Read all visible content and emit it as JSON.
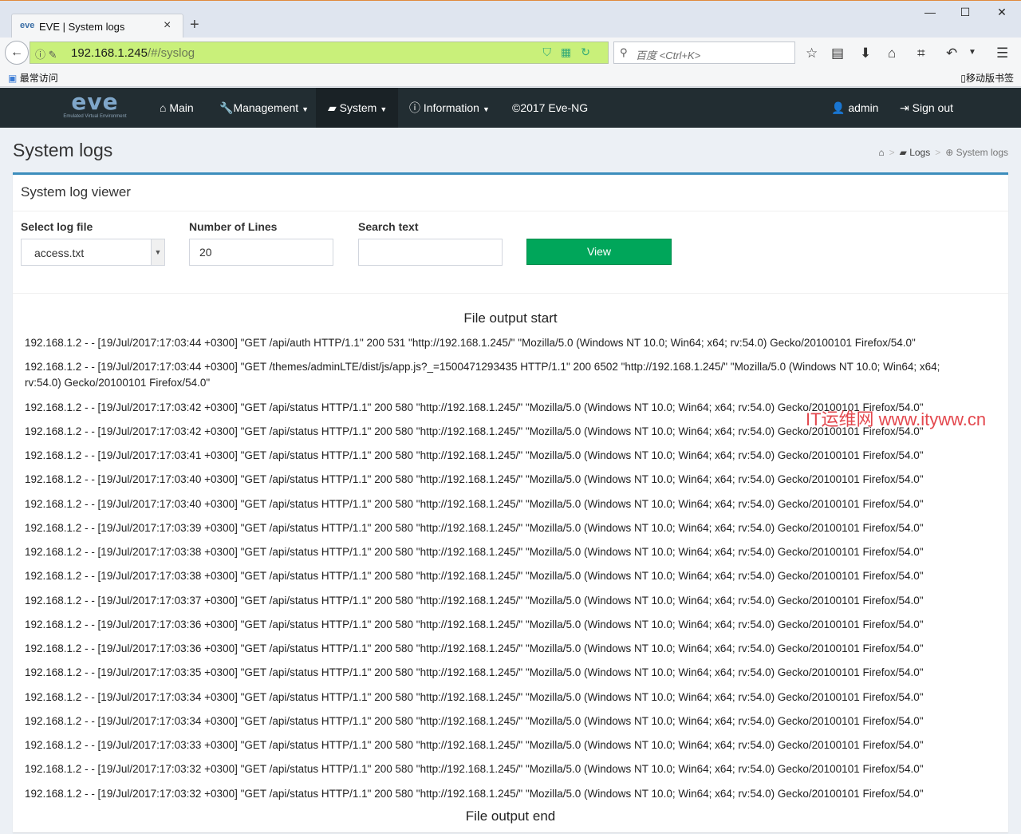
{
  "browser": {
    "tab_title": "EVE | System logs",
    "tab_logo": "eve",
    "url_host": "192.168.1.245",
    "url_path": "/#/syslog",
    "search_placeholder": "百度 <Ctrl+K>",
    "bookmark_left": "最常访问",
    "bookmark_right": "移动版书签"
  },
  "app": {
    "logo_text": "eve",
    "logo_subtext": "Emulated Virtual Environment",
    "nav": {
      "main": "Main",
      "management": "Management",
      "system": "System",
      "information": "Information",
      "copyright": "©2017 Eve-NG",
      "user": "admin",
      "signout": "Sign out"
    }
  },
  "page": {
    "title": "System logs",
    "breadcrumb": {
      "logs": "Logs",
      "current": "System logs"
    },
    "box_title": "System log viewer",
    "form": {
      "log_file_label": "Select log file",
      "log_file_value": "access.txt",
      "lines_label": "Number of Lines",
      "lines_value": "20",
      "search_label": "Search text",
      "search_value": "",
      "view_button": "View"
    },
    "output_start": "File output start",
    "output_end": "File output end",
    "log_lines": [
      "192.168.1.2 - - [19/Jul/2017:17:03:44 +0300] \"GET /api/auth HTTP/1.1\" 200 531 \"http://192.168.1.245/\" \"Mozilla/5.0 (Windows NT 10.0; Win64; x64; rv:54.0) Gecko/20100101 Firefox/54.0\"",
      "192.168.1.2 - - [19/Jul/2017:17:03:44 +0300] \"GET /themes/adminLTE/dist/js/app.js?_=1500471293435 HTTP/1.1\" 200 6502 \"http://192.168.1.245/\" \"Mozilla/5.0 (Windows NT 10.0; Win64; x64; rv:54.0) Gecko/20100101 Firefox/54.0\"",
      "192.168.1.2 - - [19/Jul/2017:17:03:42 +0300] \"GET /api/status HTTP/1.1\" 200 580 \"http://192.168.1.245/\" \"Mozilla/5.0 (Windows NT 10.0; Win64; x64; rv:54.0) Gecko/20100101 Firefox/54.0\"",
      "192.168.1.2 - - [19/Jul/2017:17:03:42 +0300] \"GET /api/status HTTP/1.1\" 200 580 \"http://192.168.1.245/\" \"Mozilla/5.0 (Windows NT 10.0; Win64; x64; rv:54.0) Gecko/20100101 Firefox/54.0\"",
      "192.168.1.2 - - [19/Jul/2017:17:03:41 +0300] \"GET /api/status HTTP/1.1\" 200 580 \"http://192.168.1.245/\" \"Mozilla/5.0 (Windows NT 10.0; Win64; x64; rv:54.0) Gecko/20100101 Firefox/54.0\"",
      "192.168.1.2 - - [19/Jul/2017:17:03:40 +0300] \"GET /api/status HTTP/1.1\" 200 580 \"http://192.168.1.245/\" \"Mozilla/5.0 (Windows NT 10.0; Win64; x64; rv:54.0) Gecko/20100101 Firefox/54.0\"",
      "192.168.1.2 - - [19/Jul/2017:17:03:40 +0300] \"GET /api/status HTTP/1.1\" 200 580 \"http://192.168.1.245/\" \"Mozilla/5.0 (Windows NT 10.0; Win64; x64; rv:54.0) Gecko/20100101 Firefox/54.0\"",
      "192.168.1.2 - - [19/Jul/2017:17:03:39 +0300] \"GET /api/status HTTP/1.1\" 200 580 \"http://192.168.1.245/\" \"Mozilla/5.0 (Windows NT 10.0; Win64; x64; rv:54.0) Gecko/20100101 Firefox/54.0\"",
      "192.168.1.2 - - [19/Jul/2017:17:03:38 +0300] \"GET /api/status HTTP/1.1\" 200 580 \"http://192.168.1.245/\" \"Mozilla/5.0 (Windows NT 10.0; Win64; x64; rv:54.0) Gecko/20100101 Firefox/54.0\"",
      "192.168.1.2 - - [19/Jul/2017:17:03:38 +0300] \"GET /api/status HTTP/1.1\" 200 580 \"http://192.168.1.245/\" \"Mozilla/5.0 (Windows NT 10.0; Win64; x64; rv:54.0) Gecko/20100101 Firefox/54.0\"",
      "192.168.1.2 - - [19/Jul/2017:17:03:37 +0300] \"GET /api/status HTTP/1.1\" 200 580 \"http://192.168.1.245/\" \"Mozilla/5.0 (Windows NT 10.0; Win64; x64; rv:54.0) Gecko/20100101 Firefox/54.0\"",
      "192.168.1.2 - - [19/Jul/2017:17:03:36 +0300] \"GET /api/status HTTP/1.1\" 200 580 \"http://192.168.1.245/\" \"Mozilla/5.0 (Windows NT 10.0; Win64; x64; rv:54.0) Gecko/20100101 Firefox/54.0\"",
      "192.168.1.2 - - [19/Jul/2017:17:03:36 +0300] \"GET /api/status HTTP/1.1\" 200 580 \"http://192.168.1.245/\" \"Mozilla/5.0 (Windows NT 10.0; Win64; x64; rv:54.0) Gecko/20100101 Firefox/54.0\"",
      "192.168.1.2 - - [19/Jul/2017:17:03:35 +0300] \"GET /api/status HTTP/1.1\" 200 580 \"http://192.168.1.245/\" \"Mozilla/5.0 (Windows NT 10.0; Win64; x64; rv:54.0) Gecko/20100101 Firefox/54.0\"",
      "192.168.1.2 - - [19/Jul/2017:17:03:34 +0300] \"GET /api/status HTTP/1.1\" 200 580 \"http://192.168.1.245/\" \"Mozilla/5.0 (Windows NT 10.0; Win64; x64; rv:54.0) Gecko/20100101 Firefox/54.0\"",
      "192.168.1.2 - - [19/Jul/2017:17:03:34 +0300] \"GET /api/status HTTP/1.1\" 200 580 \"http://192.168.1.245/\" \"Mozilla/5.0 (Windows NT 10.0; Win64; x64; rv:54.0) Gecko/20100101 Firefox/54.0\"",
      "192.168.1.2 - - [19/Jul/2017:17:03:33 +0300] \"GET /api/status HTTP/1.1\" 200 580 \"http://192.168.1.245/\" \"Mozilla/5.0 (Windows NT 10.0; Win64; x64; rv:54.0) Gecko/20100101 Firefox/54.0\"",
      "192.168.1.2 - - [19/Jul/2017:17:03:32 +0300] \"GET /api/status HTTP/1.1\" 200 580 \"http://192.168.1.245/\" \"Mozilla/5.0 (Windows NT 10.0; Win64; x64; rv:54.0) Gecko/20100101 Firefox/54.0\"",
      "192.168.1.2 - - [19/Jul/2017:17:03:32 +0300] \"GET /api/status HTTP/1.1\" 200 580 \"http://192.168.1.245/\" \"Mozilla/5.0 (Windows NT 10.0; Win64; x64; rv:54.0) Gecko/20100101 Firefox/54.0\""
    ]
  },
  "watermark": "IT运维网 www.ityww.cn",
  "colors": {
    "accent": "#3c8dbc",
    "header": "#222d32",
    "view_button": "#00a65a",
    "url_bar": "#c9f07a"
  }
}
